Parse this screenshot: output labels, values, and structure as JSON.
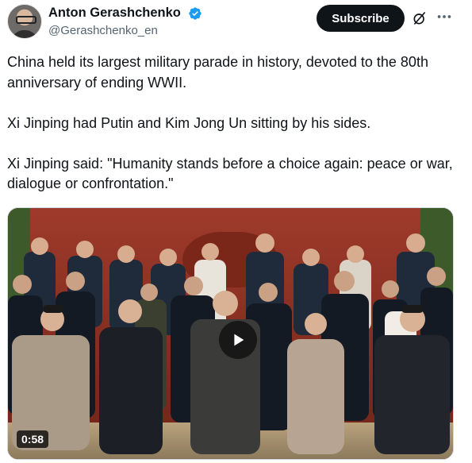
{
  "author": {
    "name": "Anton Gerashchenko",
    "handle": "@Gerashchenko_en"
  },
  "actions": {
    "subscribe_label": "Subscribe",
    "grok_icon": "grok-icon",
    "more_icon": "more-dots-icon"
  },
  "tweet": {
    "text": "China held its largest military parade in history, devoted to the 80th anniversary of ending WWII.\n\nXi Jinping had Putin and Kim Jong Un sitting by his sides.\n\nXi Jinping said: \"Humanity stands before a choice again: peace or war, dialogue or confrontation.\""
  },
  "media": {
    "duration": "0:58",
    "play_icon": "play-icon"
  },
  "colors": {
    "verified": "#1d9bf0",
    "button_bg": "#0f1419",
    "secondary_text": "#536471"
  }
}
